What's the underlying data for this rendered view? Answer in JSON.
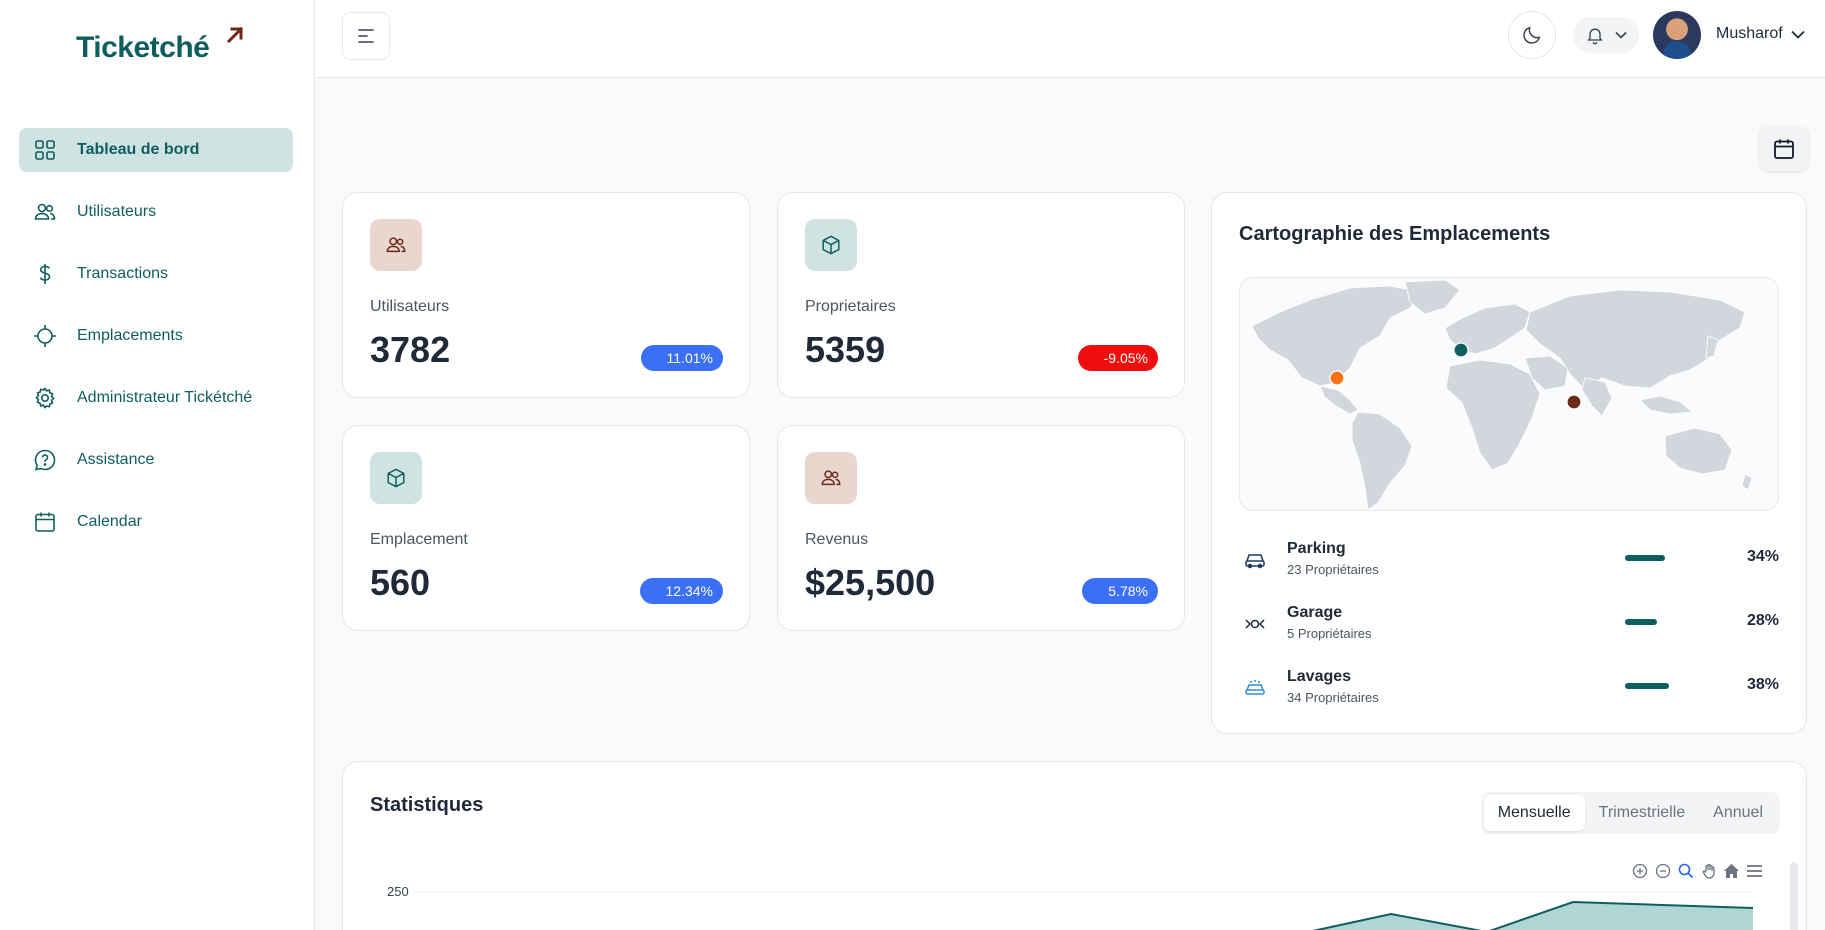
{
  "app": {
    "logo_text": "Ticketché",
    "brand_color": "#0f5e5f",
    "accent_color": "#6b2a1a"
  },
  "sidebar": {
    "items": [
      {
        "label": "Tableau de bord",
        "icon": "grid-icon",
        "active": true
      },
      {
        "label": "Utilisateurs",
        "icon": "users-icon"
      },
      {
        "label": "Transactions",
        "icon": "dollar-icon"
      },
      {
        "label": "Emplacements",
        "icon": "crosshair-icon"
      },
      {
        "label": "Administrateur Tickétché",
        "icon": "gear-icon"
      },
      {
        "label": "Assistance",
        "icon": "help-chat-icon"
      },
      {
        "label": "Calendar",
        "icon": "calendar-icon"
      }
    ]
  },
  "header": {
    "username": "Musharof"
  },
  "stats": [
    {
      "label": "Utilisateurs",
      "value": "3782",
      "badge": "11.01%",
      "trend": "up",
      "icon": "users-icon"
    },
    {
      "label": "Proprietaires",
      "value": "5359",
      "badge": "-9.05%",
      "trend": "down",
      "icon": "box-icon"
    },
    {
      "label": "Emplacement",
      "value": "560",
      "badge": "12.34%",
      "trend": "up",
      "icon": "box-icon"
    },
    {
      "label": "Revenus",
      "value": "$25,500",
      "badge": "5.78%",
      "trend": "up",
      "icon": "users-icon"
    }
  ],
  "map_card": {
    "title": "Cartographie des Emplacements",
    "markers": [
      {
        "name": "north-america",
        "color": "#f97316"
      },
      {
        "name": "europe",
        "color": "#0f5e5f"
      },
      {
        "name": "south-asia",
        "color": "#6b2a1a"
      }
    ],
    "locations": [
      {
        "name": "Parking",
        "sub": "23 Propriétaires",
        "pct": "34%",
        "fill": 0.34,
        "icon": "car-icon"
      },
      {
        "name": "Garage",
        "sub": "5 Propriétaires",
        "pct": "28%",
        "fill": 0.28,
        "icon": "wrench-car-icon"
      },
      {
        "name": "Lavages",
        "sub": "34 Propriétaires",
        "pct": "38%",
        "fill": 0.38,
        "icon": "car-wash-icon"
      }
    ]
  },
  "statistics": {
    "title": "Statistiques",
    "tabs": [
      {
        "label": "Mensuelle",
        "active": true
      },
      {
        "label": "Trimestrielle"
      },
      {
        "label": "Annuel"
      }
    ],
    "y_tick": "250",
    "toolbar": [
      "zoom-in-icon",
      "zoom-out-icon",
      "magnify-icon",
      "pan-hand-icon",
      "home-icon",
      "menu-icon"
    ]
  }
}
